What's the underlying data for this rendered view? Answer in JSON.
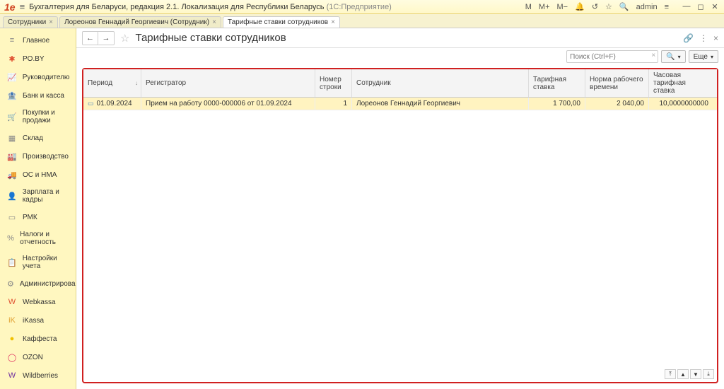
{
  "titlebar": {
    "product": "Бухгалтерия для Беларуси, редакция 2.1. Локализация для Республики Беларусь",
    "edition": "(1С:Предприятие)",
    "user": "admin",
    "scale_m": "M",
    "scale_mp": "M+",
    "scale_mm": "M−"
  },
  "tabs": [
    {
      "label": "Сотрудники",
      "active": false
    },
    {
      "label": "Лореонов Геннадий Георгиевич (Сотрудник)",
      "active": false
    },
    {
      "label": "Тарифные ставки сотрудников",
      "active": true
    }
  ],
  "sidebar": [
    {
      "icon": "≡",
      "label": "Главное",
      "color": "#888"
    },
    {
      "icon": "✱",
      "label": "PO.BY",
      "color": "#e05030"
    },
    {
      "icon": "📈",
      "label": "Руководителю",
      "color": "#e05030"
    },
    {
      "icon": "🏦",
      "label": "Банк и касса",
      "color": "#888"
    },
    {
      "icon": "🛒",
      "label": "Покупки и продажи",
      "color": "#555"
    },
    {
      "icon": "▦",
      "label": "Склад",
      "color": "#888"
    },
    {
      "icon": "🏭",
      "label": "Производство",
      "color": "#888"
    },
    {
      "icon": "🚚",
      "label": "ОС и НМА",
      "color": "#555"
    },
    {
      "icon": "👤",
      "label": "Зарплата и кадры",
      "color": "#888"
    },
    {
      "icon": "▭",
      "label": "РМК",
      "color": "#888"
    },
    {
      "icon": "%",
      "label": "Налоги и отчетность",
      "color": "#888"
    },
    {
      "icon": "📋",
      "label": "Настройки учета",
      "color": "#555"
    },
    {
      "icon": "⚙",
      "label": "Администрирование",
      "color": "#888"
    },
    {
      "icon": "W",
      "label": "Webkassa",
      "color": "#e05030"
    },
    {
      "icon": "iK",
      "label": "iKassa",
      "color": "#e0a030"
    },
    {
      "icon": "●",
      "label": "Каффеста",
      "color": "#f0c000"
    },
    {
      "icon": "◯",
      "label": "OZON",
      "color": "#e03060"
    },
    {
      "icon": "W",
      "label": "Wildberries",
      "color": "#7030a0"
    }
  ],
  "page": {
    "title": "Тарифные ставки сотрудников",
    "search_placeholder": "Поиск (Ctrl+F)",
    "btn_more": "Еще"
  },
  "grid": {
    "headers": {
      "period": "Период",
      "registrar": "Регистратор",
      "row_num": "Номер строки",
      "employee": "Сотрудник",
      "rate": "Тарифная ставка",
      "norm": "Норма рабочего времени",
      "hourly": "Часовая тарифная ставка"
    },
    "rows": [
      {
        "period": "01.09.2024",
        "registrar": "Прием на работу 0000-000006 от 01.09.2024",
        "row_num": "1",
        "employee": "Лореонов Геннадий Георгиевич",
        "rate": "1 700,00",
        "norm": "2 040,00",
        "hourly": "10,0000000000"
      }
    ]
  }
}
